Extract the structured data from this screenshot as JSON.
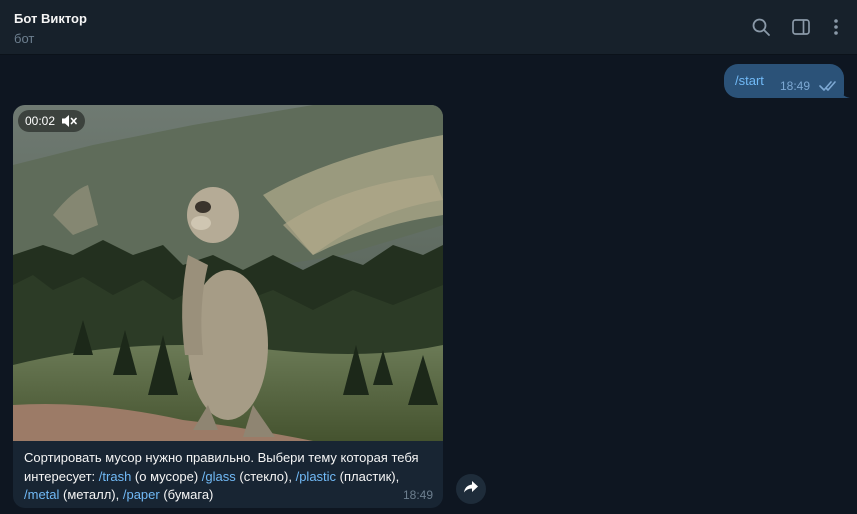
{
  "header": {
    "title": "Бот Виктор",
    "status": "бот",
    "icons": [
      "search-icon",
      "sidebar-toggle-icon",
      "more-vertical-icon"
    ]
  },
  "outgoing": {
    "text": "/start",
    "time": "18:49",
    "status": "read"
  },
  "incoming": {
    "media": {
      "type": "gif video",
      "duration": "00:02",
      "muted": true
    },
    "caption": {
      "intro": "Сортировать мусор нужно правильно. Выбери тему которая тебя интересует: ",
      "items": [
        {
          "command": "/trash",
          "desc": " (о мусоре) "
        },
        {
          "command": "/glass",
          "desc": " (стекло), "
        },
        {
          "command": "/plastic",
          "desc": " (пластик), "
        },
        {
          "command": "/metal",
          "desc": " (металл), "
        },
        {
          "command": "/paper",
          "desc": " (бумага)"
        }
      ]
    },
    "time": "18:49"
  },
  "share_icon": "share-arrow-icon",
  "colors": {
    "background": "#0e1621",
    "header": "#17212b",
    "outgoing_bubble": "#2b5278",
    "incoming_bubble": "#182533",
    "link": "#71baf7"
  }
}
